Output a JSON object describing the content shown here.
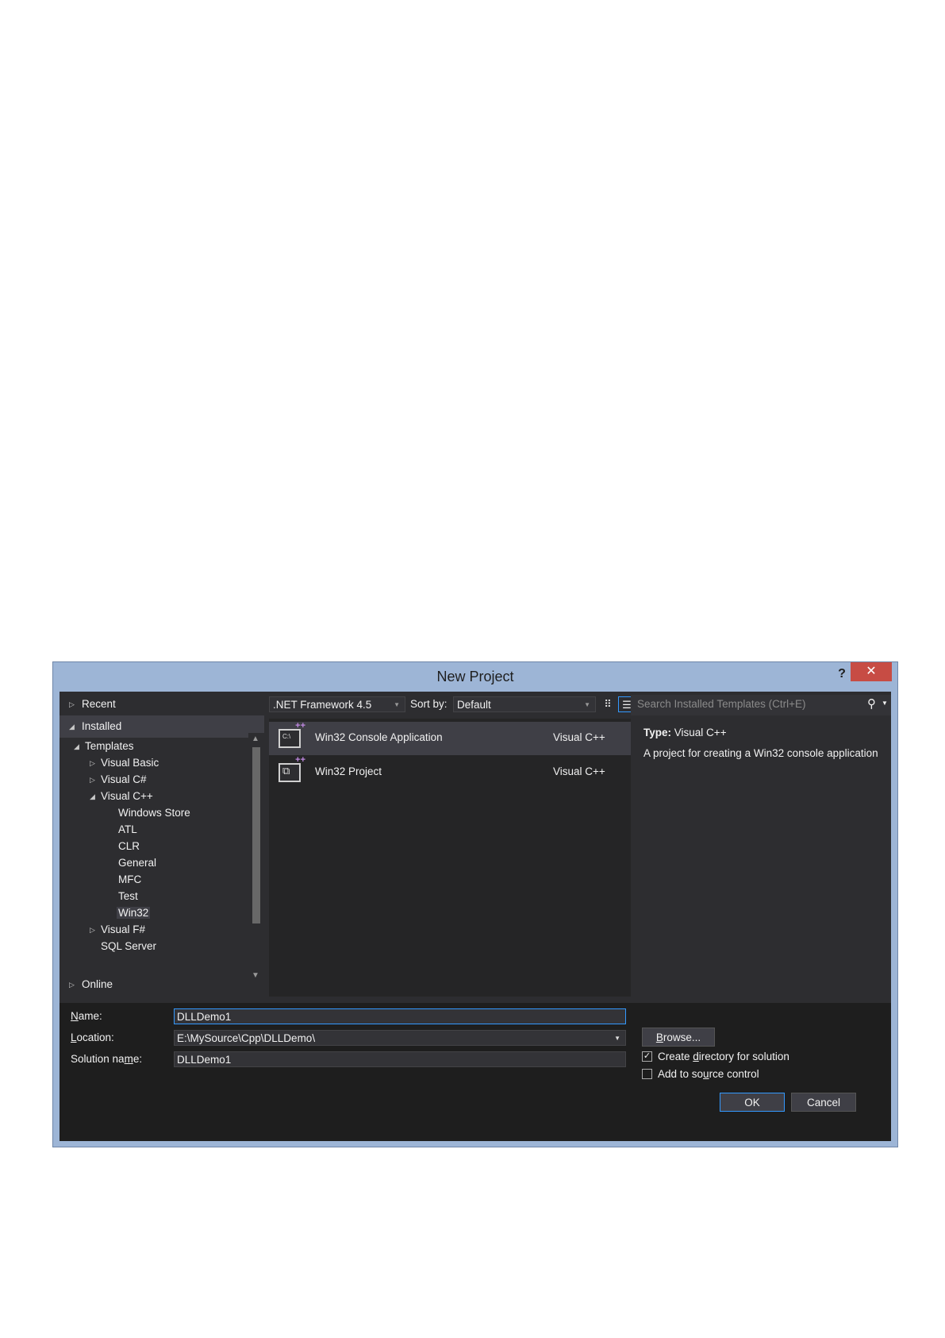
{
  "window": {
    "title": "New Project",
    "help_label": "?",
    "close_label": "✕"
  },
  "left_pane": {
    "recent": "Recent",
    "installed": "Installed",
    "online": "Online",
    "tree": [
      {
        "label": "Templates",
        "expander": "◢"
      },
      {
        "label": "Visual Basic",
        "expander": "▷"
      },
      {
        "label": "Visual C#",
        "expander": "▷"
      },
      {
        "label": "Visual C++",
        "expander": "◢"
      },
      {
        "label": "Windows Store"
      },
      {
        "label": "ATL"
      },
      {
        "label": "CLR"
      },
      {
        "label": "General"
      },
      {
        "label": "MFC"
      },
      {
        "label": "Test"
      },
      {
        "label": "Win32"
      },
      {
        "label": "Visual F#",
        "expander": "▷"
      },
      {
        "label": "SQL Server"
      }
    ]
  },
  "toolbar": {
    "framework": ".NET Framework 4.5",
    "sort_label": "Sort by:",
    "sort_value": "Default"
  },
  "templates": [
    {
      "name": "Win32 Console Application",
      "language": "Visual C++",
      "icon_glyph": "C:\\"
    },
    {
      "name": "Win32 Project",
      "language": "Visual C++",
      "icon_glyph": "⧉"
    }
  ],
  "search": {
    "placeholder": "Search Installed Templates (Ctrl+E)"
  },
  "details": {
    "type_key": "Type:",
    "type_value": "Visual C++",
    "description": "A project for creating a Win32 console application"
  },
  "form": {
    "name_label_u": "N",
    "name_label_rest": "ame:",
    "name_value": "DLLDemo1",
    "location_label_u": "L",
    "location_label_rest": "ocation:",
    "location_value": "E:\\MySource\\Cpp\\DLLDemo\\",
    "solution_label_pre": "Solution na",
    "solution_label_u": "m",
    "solution_label_post": "e:",
    "solution_value": "DLLDemo1",
    "browse_u": "B",
    "browse_rest": "rowse...",
    "create_dir_pre": "Create ",
    "create_dir_u": "d",
    "create_dir_post": "irectory for solution",
    "create_dir_checked": true,
    "source_ctrl_pre": "Add to so",
    "source_ctrl_u": "u",
    "source_ctrl_post": "rce control",
    "source_ctrl_checked": false,
    "ok": "OK",
    "cancel": "Cancel"
  }
}
